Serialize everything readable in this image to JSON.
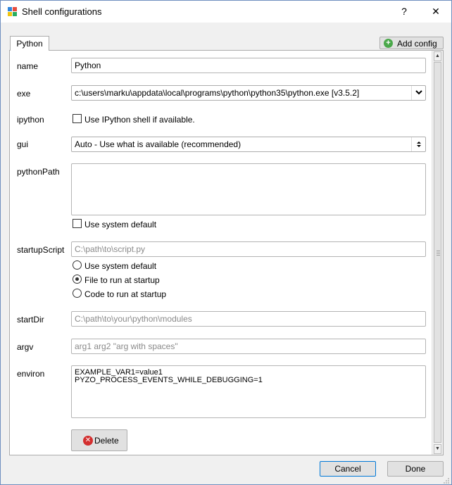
{
  "window": {
    "title": "Shell configurations",
    "help_label": "?",
    "close_label": "✕"
  },
  "tabs": [
    {
      "label": "Python"
    }
  ],
  "toolbar": {
    "add_config_label": "Add config"
  },
  "form": {
    "name": {
      "label": "name",
      "value": "Python"
    },
    "exe": {
      "label": "exe",
      "value": "c:\\users\\marku\\appdata\\local\\programs\\python\\python35\\python.exe  [v3.5.2]"
    },
    "ipython": {
      "label": "ipython",
      "checkbox_label": "Use IPython shell if available.",
      "checked": false
    },
    "gui": {
      "label": "gui",
      "value": "Auto  -  Use what is available (recommended)"
    },
    "pythonPath": {
      "label": "pythonPath",
      "value": "",
      "system_default_label": "Use system default",
      "system_default_checked": false
    },
    "startupScript": {
      "label": "startupScript",
      "placeholder": "C:\\path\\to\\script.py",
      "options": [
        {
          "label": "Use system default",
          "selected": false
        },
        {
          "label": "File to run at startup",
          "selected": true
        },
        {
          "label": "Code to run at startup",
          "selected": false
        }
      ]
    },
    "startDir": {
      "label": "startDir",
      "placeholder": "C:\\path\\to\\your\\python\\modules"
    },
    "argv": {
      "label": "argv",
      "placeholder": "arg1 arg2 \"arg with spaces\""
    },
    "environ": {
      "label": "environ",
      "value": "EXAMPLE_VAR1=value1\nPYZO_PROCESS_EVENTS_WHILE_DEBUGGING=1"
    }
  },
  "delete_label": "Delete",
  "footer": {
    "cancel_label": "Cancel",
    "done_label": "Done"
  },
  "colors": {
    "accent": "#0078d7",
    "add_icon": "#4aa84a",
    "delete_icon": "#d32f2f",
    "logo": [
      "#e84c3d",
      "#2e86de",
      "#f1c40f",
      "#27ae60"
    ]
  }
}
